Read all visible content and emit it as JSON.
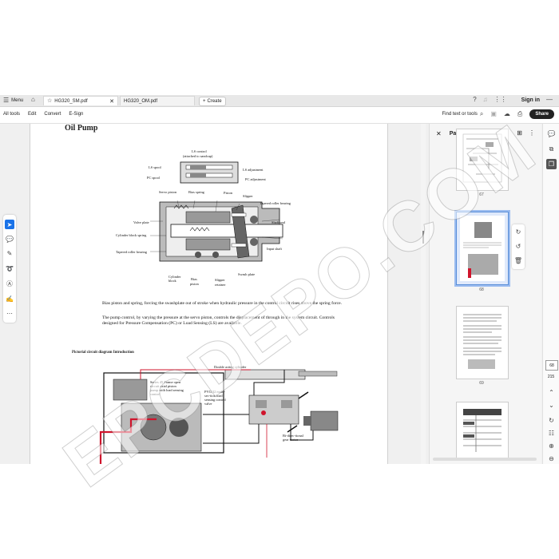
{
  "tabbar": {
    "menu_label": "Menu",
    "active_tab": "HG320_SM.pdf",
    "other_tab": "HG320_OM.pdf",
    "create_label": "Create",
    "sign_in": "Sign in"
  },
  "menubar": {
    "items": [
      "All tools",
      "Edit",
      "Convert",
      "E-Sign"
    ],
    "find_label": "Find text or tools",
    "share_label": "Share"
  },
  "document": {
    "title": "Oil Pump",
    "fig1_labels": {
      "ls_control": "LS control",
      "attached": "(attached to sandcap)",
      "ls_spool": "LS spool",
      "pc_spool": "PC spool",
      "ls_adjustment": "LS adjustment",
      "pc_adjustment": "PC adjustment",
      "servo_piston": "Servo piston",
      "bias_spring": "Bias spring",
      "piston": "Piston",
      "slipper": "Slipper",
      "tapered_roller_bearing_top": "Tapered roller  bearing",
      "shaft_seal": "Shaft seal",
      "valve_plate": "Valve  plate",
      "cylinder_block_spring": "Cylinder  block  spring",
      "input_shaft": "Input shaft",
      "tapered_roller_bearing_left": "Tapered  roller  bearing",
      "swash_plate": "Swash plate",
      "cylinder_block": "Cylinder",
      "cylinder_block2": "block",
      "bias_piston": "Bias",
      "bias_piston2": "piston",
      "slipper_retainer": "Slipper",
      "slipper_retainer2": "retainer"
    },
    "para1": "Bias piston and spring, forcing the swashplate out of stroke when hydraulic pressure in the control circuit rises above the spring force.",
    "para2": "The pump control, by varying the pressure at the servo piston, controls the displacement of through in the  system circuit. Controls designed for Pressure Compensation (PC) or Load Sensing (LS) are available.",
    "subhead": "Pictorial circuit diagram  Introduction",
    "fig2_labels": {
      "double_acting": "Double acting cylinder",
      "series45": "Series 45 Frame open circuit axial piston pump with load sensing control",
      "pvg": "PVG 32 multi-sec-tion  load sensing control valve",
      "bidirectional": "Bi-direc-tional  gear motor"
    },
    "watermark": "EPCDEPO.COM"
  },
  "pages_panel": {
    "title": "Pages",
    "page_labels": [
      "67",
      "68",
      "69"
    ]
  },
  "rail": {
    "current_page": "68",
    "total_pages": "215"
  }
}
